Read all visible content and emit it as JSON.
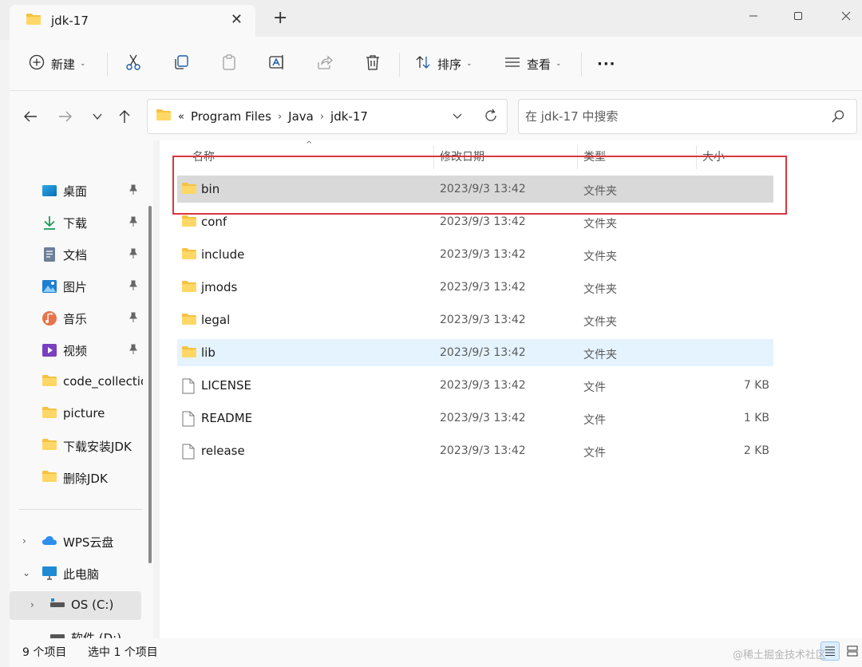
{
  "tab": {
    "title": "jdk-17",
    "icon": "folder-icon"
  },
  "window_controls": [
    "minimize-icon",
    "maximize-icon",
    "close-icon"
  ],
  "toolbar": {
    "new_label": "新建",
    "sort_label": "排序",
    "view_label": "查看",
    "more_label": "···"
  },
  "address": {
    "crumbs": [
      "Program Files",
      "Java",
      "jdk-17"
    ],
    "prefix": "«"
  },
  "search": {
    "placeholder": "在 jdk-17 中搜索"
  },
  "sidebar": {
    "pinned": [
      {
        "label": "桌面",
        "icon": "desktop-icon"
      },
      {
        "label": "下载",
        "icon": "download-icon"
      },
      {
        "label": "文档",
        "icon": "document-icon"
      },
      {
        "label": "图片",
        "icon": "pictures-icon"
      },
      {
        "label": "音乐",
        "icon": "music-icon"
      },
      {
        "label": "视频",
        "icon": "video-icon"
      }
    ],
    "folders": [
      {
        "label": "code_collection",
        "icon": "folder-icon"
      },
      {
        "label": "picture",
        "icon": "folder-icon"
      },
      {
        "label": "下载安装JDK",
        "icon": "folder-icon"
      },
      {
        "label": "删除JDK",
        "icon": "folder-icon"
      }
    ],
    "locations": [
      {
        "label": "WPS云盘",
        "icon": "cloud-icon"
      },
      {
        "label": "此电脑",
        "icon": "computer-icon"
      },
      {
        "label": "OS (C:)",
        "icon": "drive-icon"
      },
      {
        "label": "软件 (D:)",
        "icon": "drive-icon"
      }
    ]
  },
  "columns": {
    "name": "名称",
    "date": "修改日期",
    "type": "类型",
    "size": "大小"
  },
  "files": [
    {
      "name": "bin",
      "date": "2023/9/3 13:42",
      "type": "文件夹",
      "size": "",
      "icon": "folder-icon"
    },
    {
      "name": "conf",
      "date": "2023/9/3 13:42",
      "type": "文件夹",
      "size": "",
      "icon": "folder-icon"
    },
    {
      "name": "include",
      "date": "2023/9/3 13:42",
      "type": "文件夹",
      "size": "",
      "icon": "folder-icon"
    },
    {
      "name": "jmods",
      "date": "2023/9/3 13:42",
      "type": "文件夹",
      "size": "",
      "icon": "folder-icon"
    },
    {
      "name": "legal",
      "date": "2023/9/3 13:42",
      "type": "文件夹",
      "size": "",
      "icon": "folder-icon"
    },
    {
      "name": "lib",
      "date": "2023/9/3 13:42",
      "type": "文件夹",
      "size": "",
      "icon": "folder-icon"
    },
    {
      "name": "LICENSE",
      "date": "2023/9/3 13:42",
      "type": "文件",
      "size": "7 KB",
      "icon": "file-icon"
    },
    {
      "name": "README",
      "date": "2023/9/3 13:42",
      "type": "文件",
      "size": "1 KB",
      "icon": "file-icon"
    },
    {
      "name": "release",
      "date": "2023/9/3 13:42",
      "type": "文件",
      "size": "2 KB",
      "icon": "file-icon"
    }
  ],
  "status": {
    "count": "9 个项目",
    "selected": "选中 1 个项目"
  },
  "watermark": "@稀土掘金技术社区",
  "colors": {
    "accent": "#0067c0",
    "folder": "#f5c242",
    "highlight": "#d9383e",
    "selected_row": "#d9d9d9",
    "hover_row": "#e5f3ff"
  }
}
